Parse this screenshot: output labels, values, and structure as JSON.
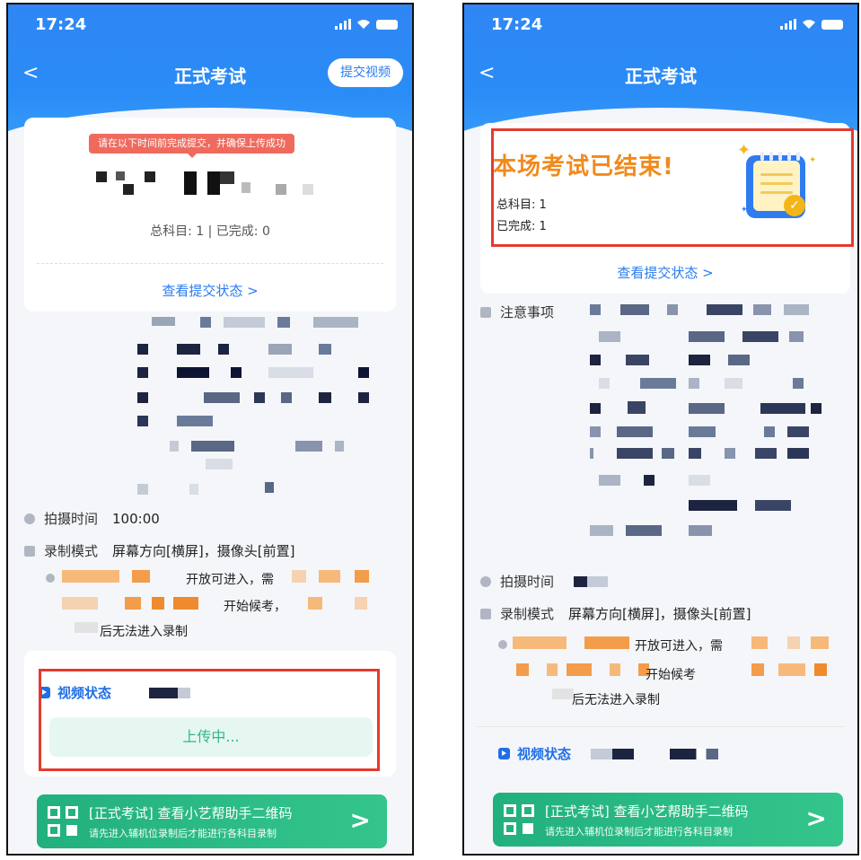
{
  "status_bar": {
    "time": "17:24"
  },
  "left": {
    "nav_title": "正式考试",
    "submit_button": "提交视频",
    "deadline_tip": "请在以下时间前完成提交，并确保上传成功",
    "progress_text": "总科目: 1  |  已完成: 0",
    "view_status_link": "查看提交状态 >",
    "shoot_time_label": "拍摄时间",
    "shoot_time_value": "100:00",
    "record_mode_label": "录制模式",
    "record_mode_value": "屏幕方向[横屏]，摄像头[前置]",
    "notice_line1": "开放可进入，需",
    "notice_line2": "开始候考，",
    "notice_line3": "后无法进入录制",
    "video_status_label": "视频状态",
    "upload_status": "上传中..."
  },
  "right": {
    "nav_title": "正式考试",
    "ended_title": "本场考试已结束!",
    "total_subjects": "总科目: 1",
    "completed": "已完成: 1",
    "view_status_link": "查看提交状态 >",
    "notice_label": "注意事项",
    "shoot_time_label": "拍摄时间",
    "record_mode_label": "录制模式",
    "record_mode_value": "屏幕方向[横屏]，摄像头[前置]",
    "notice_line1": "开放可进入，需",
    "notice_line2": "开始候考",
    "notice_line3": "后无法进入录制",
    "video_status_label": "视频状态"
  },
  "banner": {
    "title": "[正式考试] 查看小艺帮助手二维码",
    "subtitle": "请先进入辅机位录制后才能进行各科目录制",
    "arrow": ">"
  },
  "icons": [
    "back-icon",
    "signal-icon",
    "wifi-icon",
    "battery-icon",
    "clock-icon",
    "camera-icon",
    "notice-icon",
    "play-icon",
    "qr-icon",
    "chevron-right-icon"
  ],
  "colors": {
    "header_blue": "#2f86f4",
    "accent_red": "#e53a2f",
    "ended_orange": "#f08a1c",
    "upload_green": "#33b886",
    "banner_green": "#22b07d"
  }
}
